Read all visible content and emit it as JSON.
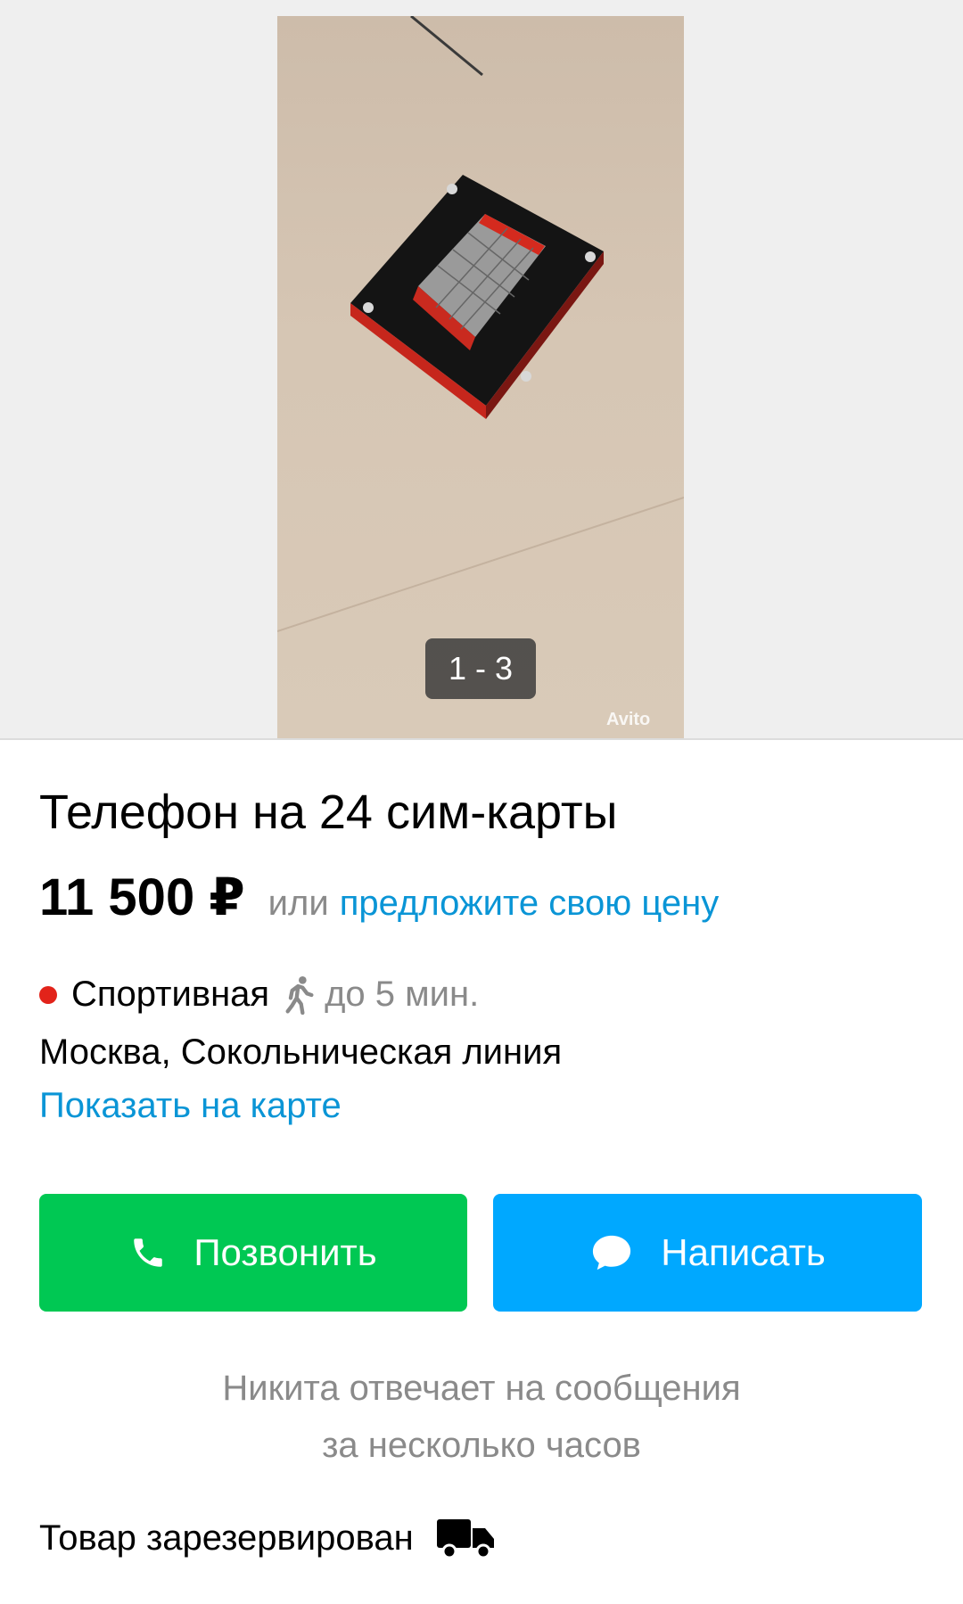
{
  "gallery": {
    "counter": "1 - 3",
    "watermark": "Avito"
  },
  "listing": {
    "title": "Телефон на 24 сим-карты",
    "price": "11 500 ₽",
    "price_or": "или",
    "offer_link": "предложите свою цену"
  },
  "location": {
    "metro_station": "Спортивная",
    "metro_color": "#e2231a",
    "walk_icon": "walking-person-icon",
    "walk_time": "до 5 мин.",
    "address": "Москва, Сокольническая линия",
    "map_link": "Показать на карте"
  },
  "actions": {
    "call_label": "Позвонить",
    "call_color": "#00c853",
    "write_label": "Написать",
    "write_color": "#00a8ff"
  },
  "seller": {
    "reply_line1": "Никита отвечает на сообщения",
    "reply_line2": "за несколько часов"
  },
  "status": {
    "reserved_label": "Товар зарезервирован",
    "delivery_icon": "truck-icon"
  }
}
